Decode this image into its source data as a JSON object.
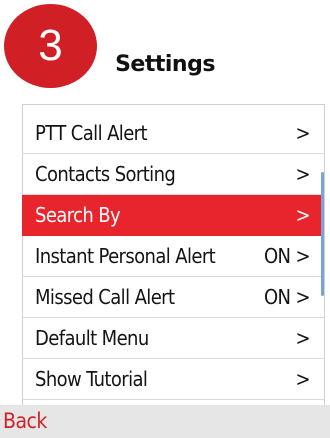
{
  "badge": {
    "number": "3"
  },
  "header": {
    "title": "Settings"
  },
  "menu": {
    "items": [
      {
        "label": "PTT Call Alert",
        "right": ">",
        "selected": false
      },
      {
        "label": "Contacts Sorting",
        "right": ">",
        "selected": false
      },
      {
        "label": "Search By",
        "right": ">",
        "selected": true
      },
      {
        "label": "Instant Personal Alert",
        "right": "ON >",
        "selected": false
      },
      {
        "label": "Missed Call Alert",
        "right": "ON >",
        "selected": false
      },
      {
        "label": "Default Menu",
        "right": ">",
        "selected": false
      },
      {
        "label": "Show Tutorial",
        "right": ">",
        "selected": false
      }
    ]
  },
  "footer": {
    "back_label": "Back"
  },
  "colors": {
    "accent": "#e8242c",
    "badge": "#d11f26",
    "footer_bg": "#e6e6e6",
    "scrollbar": "#7aa3d6"
  }
}
